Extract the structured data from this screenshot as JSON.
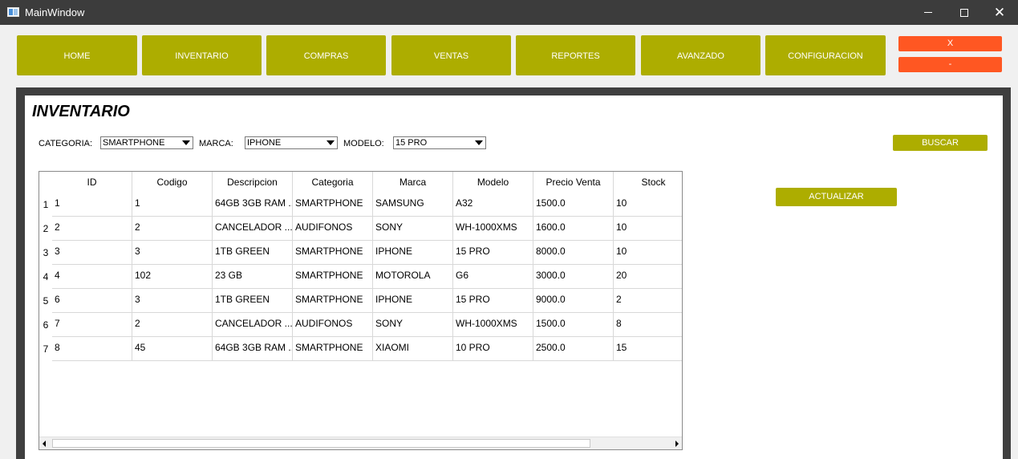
{
  "window": {
    "title": "MainWindow"
  },
  "nav": {
    "items": [
      "HOME",
      "INVENTARIO",
      "COMPRAS",
      "VENTAS",
      "REPORTES",
      "AVANZADO",
      "CONFIGURACION"
    ],
    "close_label": "X",
    "minimize_label": "-"
  },
  "page": {
    "title": "INVENTARIO"
  },
  "filters": {
    "categoria_label": "CATEGORIA:",
    "categoria_value": "SMARTPHONE",
    "marca_label": "MARCA:",
    "marca_value": "IPHONE",
    "modelo_label": "MODELO:",
    "modelo_value": "15 PRO",
    "buscar_label": "BUSCAR"
  },
  "actualizar_label": "ACTUALIZAR",
  "table": {
    "headers": [
      "ID",
      "Codigo",
      "Descripcion",
      "Categoria",
      "Marca",
      "Modelo",
      "Precio Venta",
      "Stock"
    ],
    "row_numbers": [
      "1",
      "2",
      "3",
      "4",
      "5",
      "6",
      "7"
    ],
    "rows": [
      [
        "1",
        "1",
        "64GB 3GB RAM ...",
        "SMARTPHONE",
        "SAMSUNG",
        "A32",
        "1500.0",
        "10"
      ],
      [
        "2",
        "2",
        "CANCELADOR ...",
        "AUDIFONOS",
        "SONY",
        "WH-1000XMS",
        "1600.0",
        "10"
      ],
      [
        "3",
        "3",
        "1TB GREEN",
        "SMARTPHONE",
        "IPHONE",
        "15 PRO",
        "8000.0",
        "10"
      ],
      [
        "4",
        "102",
        "23 GB",
        "SMARTPHONE",
        "MOTOROLA",
        "G6",
        "3000.0",
        "20"
      ],
      [
        "6",
        "3",
        "1TB GREEN",
        "SMARTPHONE",
        "IPHONE",
        "15 PRO",
        "9000.0",
        "2"
      ],
      [
        "7",
        "2",
        "CANCELADOR ...",
        "AUDIFONOS",
        "SONY",
        "WH-1000XMS",
        "1500.0",
        "8"
      ],
      [
        "8",
        "45",
        "64GB 3GB RAM ...",
        "SMARTPHONE",
        "XIAOMI",
        "10 PRO",
        "2500.0",
        "15"
      ]
    ]
  },
  "colors": {
    "accent": "#adad00",
    "danger": "#ff5722",
    "titlebar": "#3c3c3c"
  }
}
